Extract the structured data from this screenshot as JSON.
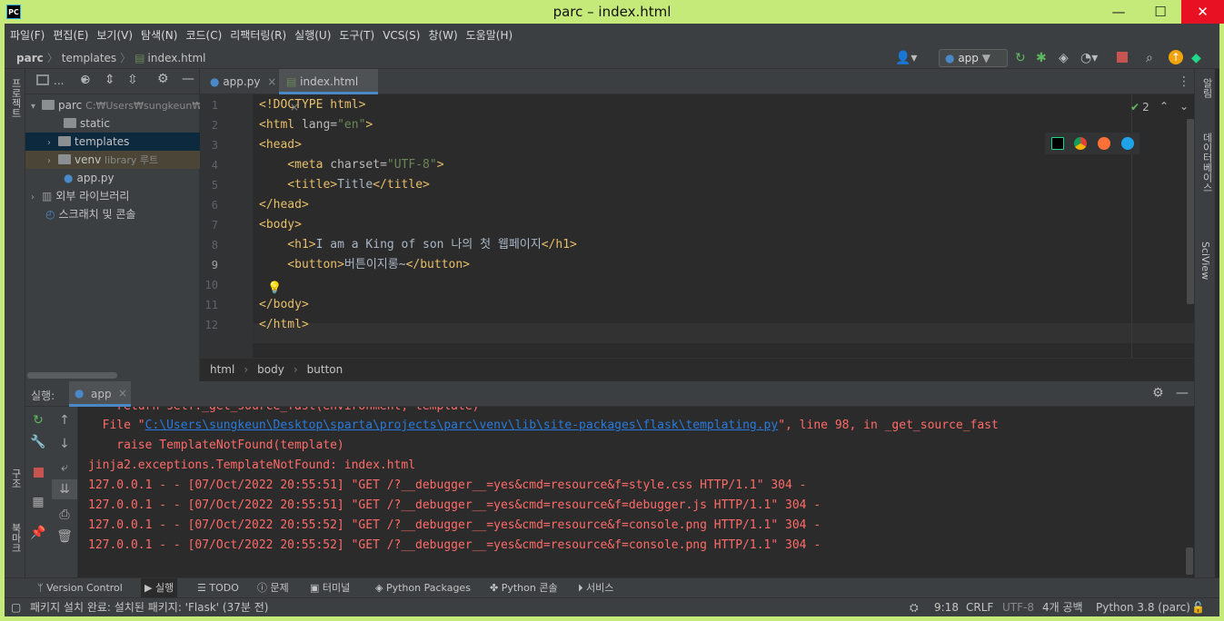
{
  "window": {
    "title": "parc – index.html",
    "minimize": "—",
    "maximize": "☐",
    "close": "✕"
  },
  "menu": [
    "파일(F)",
    "편집(E)",
    "보기(V)",
    "탐색(N)",
    "코드(C)",
    "리팩터링(R)",
    "실행(U)",
    "도구(T)",
    "VCS(S)",
    "창(W)",
    "도움말(H)"
  ],
  "breadcrumb": {
    "project": "parc",
    "folder": "templates",
    "file": "index.html"
  },
  "run_config": "app",
  "project_panel": {
    "title": "...",
    "items": [
      {
        "label": "parc",
        "hint": "C:₩Users₩sungkeun₩"
      },
      {
        "label": "static",
        "hint": ""
      },
      {
        "label": "templates",
        "hint": ""
      },
      {
        "label": "venv",
        "hint": "library 루트"
      },
      {
        "label": "app.py",
        "hint": ""
      },
      {
        "label": "외부 라이브러리",
        "hint": ""
      },
      {
        "label": "스크래치 및 콘솔",
        "hint": ""
      }
    ]
  },
  "left_strip": {
    "project": "프로젝트",
    "structure": "구조",
    "bookmarks": "북마크"
  },
  "right_strip": {
    "notifications": "알림",
    "database": "데이터베이스",
    "sciview": "SciView"
  },
  "tabs": [
    {
      "label": "app.py"
    },
    {
      "label": "index.html"
    }
  ],
  "inspection_count": "2",
  "editor": {
    "line_numbers": [
      "1",
      "2",
      "3",
      "4",
      "5",
      "6",
      "7",
      "8",
      "9",
      "10",
      "11",
      "12"
    ],
    "l1": "<!DOCTYPE html>",
    "l2_open": "<html",
    "l2_attr": " lang=",
    "l2_val": "\"en\"",
    "l2_close": ">",
    "l3": "<head>",
    "l4_open": "    <meta",
    "l4_attr": " charset=",
    "l4_val": "\"UTF-8\"",
    "l4_close": ">",
    "l5_open": "    <title>",
    "l5_text": "Title",
    "l5_close": "</title>",
    "l6": "</head>",
    "l7": "<body>",
    "l8_open": "    <h1>",
    "l8_text": "I am a King of son 나의 첫 웹페이지",
    "l8_close": "</h1>",
    "l9_open": "    <button>",
    "l9_text": "버튼이지롱~",
    "l9_close": "</button>",
    "l11": "</body>",
    "l12": "</html>"
  },
  "editor_breadcrumb": [
    "html",
    "body",
    "button"
  ],
  "run_panel": {
    "label": "실행:",
    "config": "app"
  },
  "console_lines": {
    "c0": "    return self._get_source_fast(environment, template)",
    "c1_pre": "  File \"",
    "c1_link": "C:\\Users\\sungkeun\\Desktop\\sparta\\projects\\parc\\venv\\lib\\site-packages\\flask\\templating.py",
    "c1_post": "\", line 98, in _get_source_fast",
    "c2": "    raise TemplateNotFound(template)",
    "c3": "jinja2.exceptions.TemplateNotFound: index.html",
    "c4": "127.0.0.1 - - [07/Oct/2022 20:55:51] \"GET /?__debugger__=yes&cmd=resource&f=style.css HTTP/1.1\" 304 -",
    "c5": "127.0.0.1 - - [07/Oct/2022 20:55:51] \"GET /?__debugger__=yes&cmd=resource&f=debugger.js HTTP/1.1\" 304 -",
    "c6": "127.0.0.1 - - [07/Oct/2022 20:55:52] \"GET /?__debugger__=yes&cmd=resource&f=console.png HTTP/1.1\" 304 -",
    "c7": "127.0.0.1 - - [07/Oct/2022 20:55:52] \"GET /?__debugger__=yes&cmd=resource&f=console.png HTTP/1.1\" 304 -"
  },
  "bottom_tabs": [
    "Version Control",
    "실행",
    "TODO",
    "문제",
    "터미널",
    "Python Packages",
    "Python 콘솔",
    "서비스"
  ],
  "status": {
    "message": "패키지 설치 완료: 설치된 패키지: 'Flask' (37분 전)",
    "position": "9:18",
    "line_sep": "CRLF",
    "encoding": "UTF-8",
    "indent": "4개 공백",
    "interpreter": "Python 3.8 (parc)"
  },
  "colors": {
    "title_bar": "#c6ea79",
    "panel": "#3c3f41",
    "editor_bg": "#2b2b2b",
    "tag": "#e8bf6a",
    "string": "#6a8759",
    "error_text": "#ff6b68",
    "link": "#287bde"
  },
  "icons": [
    "pycharm-icon",
    "hammer-icon",
    "run-icon",
    "debug-icon",
    "coverage-icon",
    "profile-icon",
    "stop-icon",
    "search-icon",
    "update-icon",
    "jetbrains-icon",
    "user-icon"
  ]
}
